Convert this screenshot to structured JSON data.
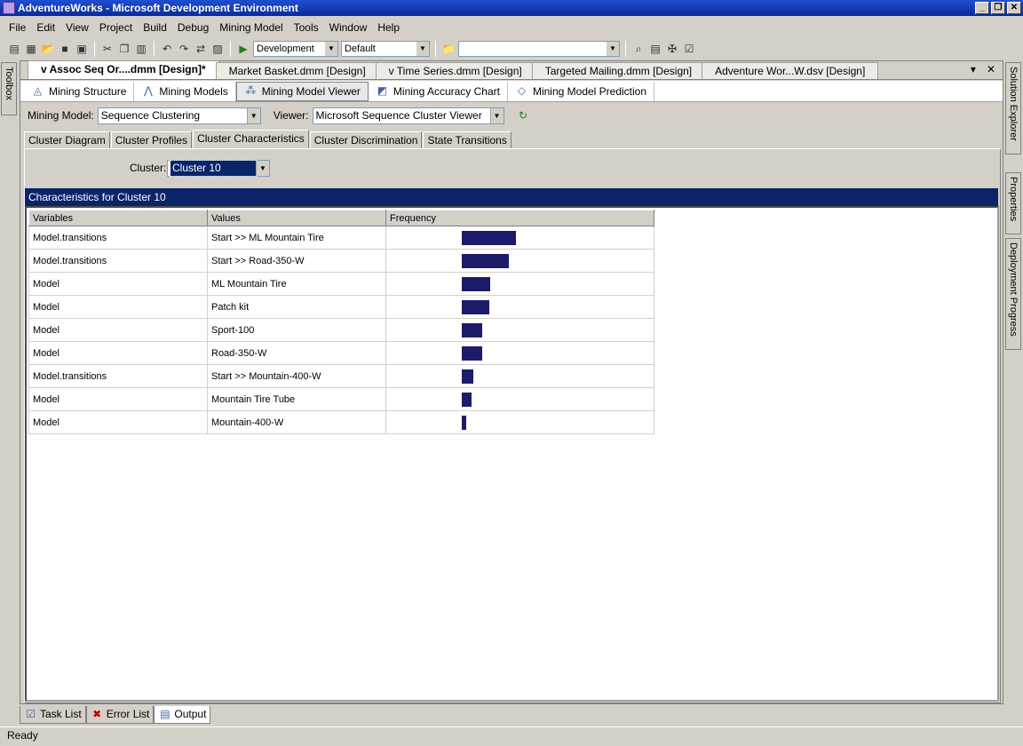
{
  "window": {
    "title": "AdventureWorks - Microsoft Development Environment"
  },
  "menu": [
    "File",
    "Edit",
    "View",
    "Project",
    "Build",
    "Debug",
    "Mining Model",
    "Tools",
    "Window",
    "Help"
  ],
  "toolbar": {
    "config": "Development",
    "platform": "Default",
    "find": ""
  },
  "left_dock": {
    "toolbox": "Toolbox"
  },
  "right_dock": {
    "solution_explorer": "Solution Explorer",
    "properties": "Properties",
    "deployment": "Deployment Progress"
  },
  "doc_tabs": [
    "v Assoc Seq Or....dmm [Design]*",
    "Market Basket.dmm [Design]",
    "v Time Series.dmm [Design]",
    "Targeted Mailing.dmm [Design]",
    "Adventure Wor...W.dsv [Design]"
  ],
  "designer_tabs": [
    "Mining Structure",
    "Mining Models",
    "Mining Model Viewer",
    "Mining Accuracy Chart",
    "Mining Model Prediction"
  ],
  "mining_model": {
    "label": "Mining Model:",
    "value": "Sequence Clustering"
  },
  "viewer": {
    "label": "Viewer:",
    "value": "Microsoft Sequence Cluster Viewer"
  },
  "view_tabs": [
    "Cluster Diagram",
    "Cluster Profiles",
    "Cluster Characteristics",
    "Cluster Discrimination",
    "State Transitions"
  ],
  "cluster": {
    "label": "Cluster:",
    "value": "Cluster 10"
  },
  "characteristics": {
    "header": "Characteristics for Cluster 10",
    "columns": [
      "Variables",
      "Values",
      "Frequency"
    ],
    "rows": [
      {
        "variable": "Model.transitions",
        "value": "Start >> ML Mountain Tire",
        "frequency": 0.61
      },
      {
        "variable": "Model.transitions",
        "value": "Start >> Road-350-W",
        "frequency": 0.53
      },
      {
        "variable": "Model",
        "value": "ML Mountain Tire",
        "frequency": 0.32
      },
      {
        "variable": "Model",
        "value": "Patch kit",
        "frequency": 0.31
      },
      {
        "variable": "Model",
        "value": "Sport-100",
        "frequency": 0.23
      },
      {
        "variable": "Model",
        "value": "Road-350-W",
        "frequency": 0.23
      },
      {
        "variable": "Model.transitions",
        "value": "Start >> Mountain-400-W",
        "frequency": 0.13
      },
      {
        "variable": "Model",
        "value": "Mountain Tire Tube",
        "frequency": 0.11
      },
      {
        "variable": "Model",
        "value": "Mountain-400-W",
        "frequency": 0.05
      }
    ]
  },
  "bottom_tabs": [
    "Task List",
    "Error List",
    "Output"
  ],
  "status": "Ready",
  "colors": {
    "title": "#0a246a",
    "bar": "#1c1c6a"
  }
}
